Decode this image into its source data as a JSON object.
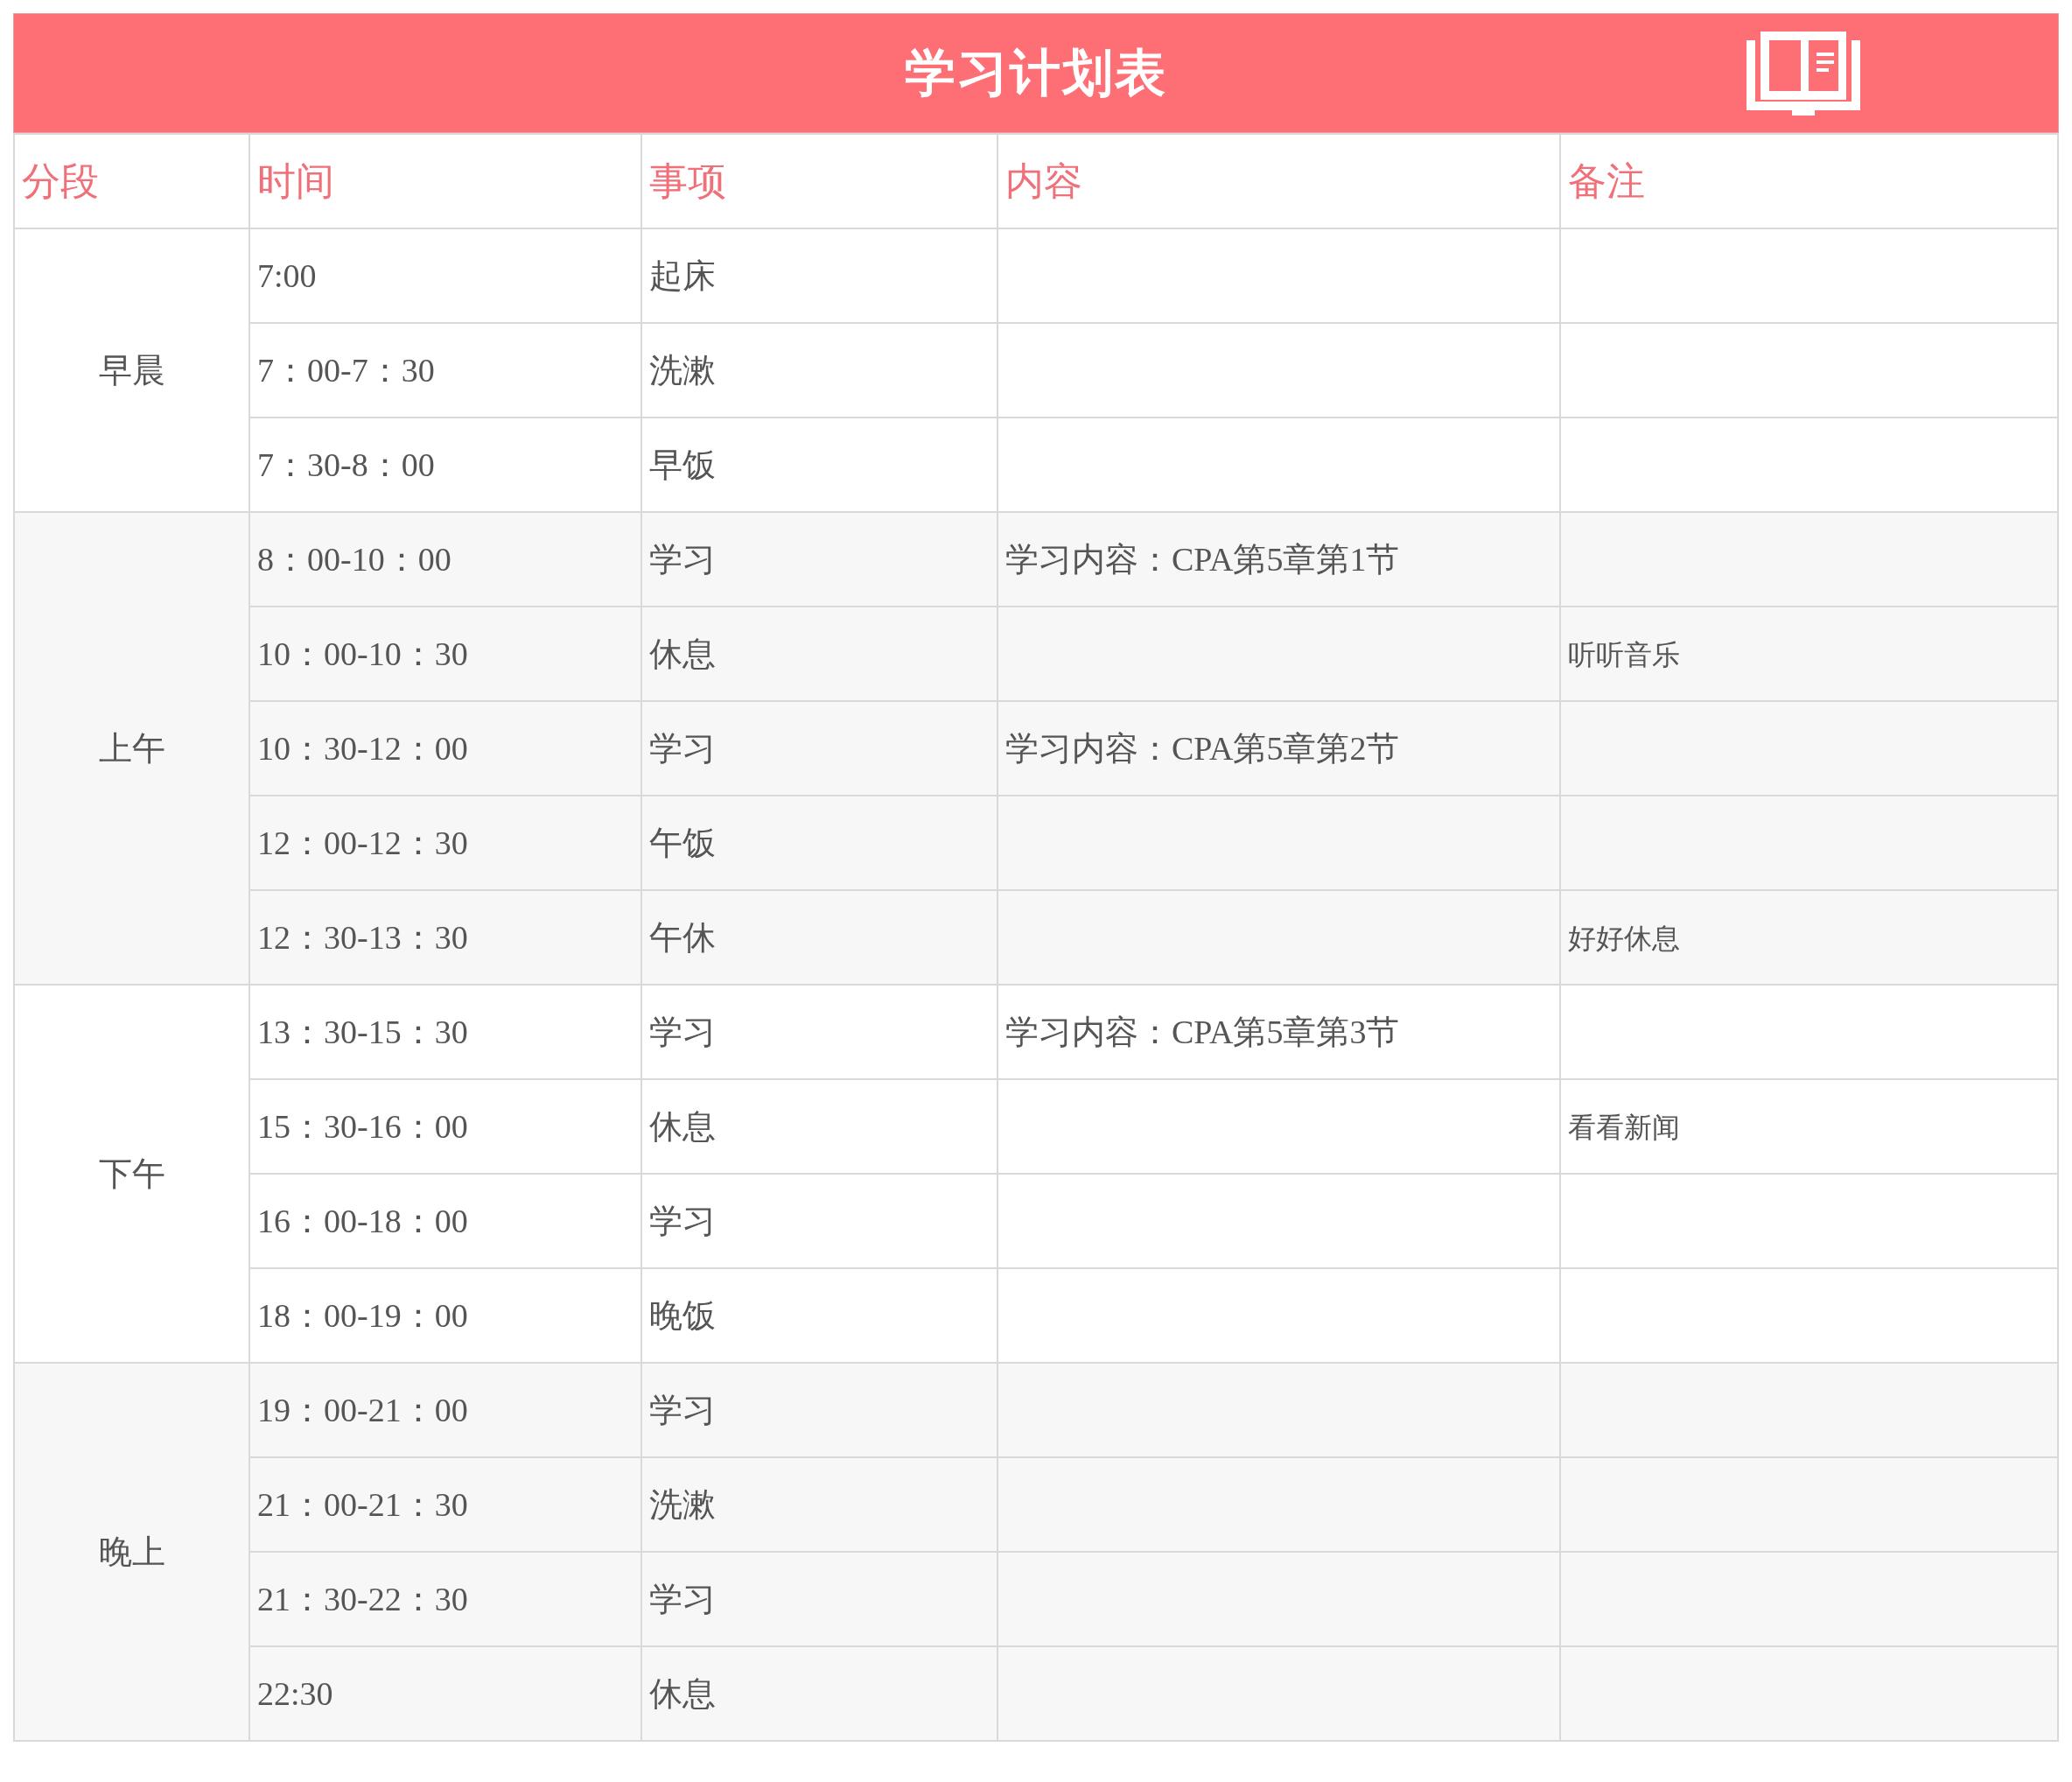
{
  "title": "学习计划表",
  "columns": [
    "分段",
    "时间",
    "事项",
    "内容",
    "备注"
  ],
  "segments": [
    {
      "name": "早晨",
      "rows": [
        {
          "time": "7:00",
          "item": "起床"
        },
        {
          "time": "7：00-7：30",
          "item": "洗漱"
        },
        {
          "time": "7：30-8：00",
          "item": "早饭"
        }
      ]
    },
    {
      "name": "上午",
      "rows": [
        {
          "time": "8：00-10：00",
          "item": "学习",
          "content": "学习内容：CPA第5章第1节"
        },
        {
          "time": "10：00-10：30",
          "item": "休息",
          "note": "听听音乐"
        },
        {
          "time": "10：30-12：00",
          "item": "学习",
          "content": "学习内容：CPA第5章第2节"
        },
        {
          "time": "12：00-12：30",
          "item": "午饭"
        },
        {
          "time": "12：30-13：30",
          "item": "午休",
          "note": "好好休息"
        }
      ]
    },
    {
      "name": "下午",
      "rows": [
        {
          "time": "13：30-15：30",
          "item": "学习",
          "content": "学习内容：CPA第5章第3节"
        },
        {
          "time": "15：30-16：00",
          "item": "休息",
          "note": "看看新闻"
        },
        {
          "time": "16：00-18：00",
          "item": "学习"
        },
        {
          "time": "18：00-19：00",
          "item": "晚饭"
        }
      ]
    },
    {
      "name": "晚上",
      "rows": [
        {
          "time": "19：00-21：00",
          "item": "学习"
        },
        {
          "time": "21：00-21：30",
          "item": "洗漱"
        },
        {
          "time": "21：30-22：30",
          "item": "学习"
        },
        {
          "time": "22:30",
          "item": "休息"
        }
      ]
    }
  ]
}
